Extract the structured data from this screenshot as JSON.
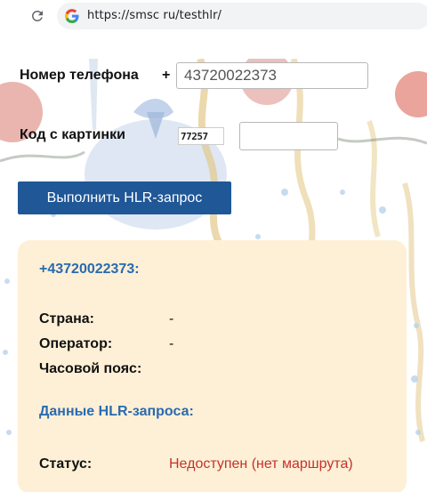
{
  "browser": {
    "url": "https://smsc ru/testhlr/"
  },
  "form": {
    "phone_label": "Номер телефона",
    "plus_sign": "+",
    "phone_value": "43720022373",
    "captcha_label": "Код с картинки",
    "captcha_code": "77257",
    "captcha_value": "",
    "submit_label": "Выполнить HLR-запрос"
  },
  "result": {
    "phone_heading": "+43720022373:",
    "rows": [
      {
        "label": "Страна:",
        "value": "-"
      },
      {
        "label": "Оператор:",
        "value": "-"
      },
      {
        "label": "Часовой пояс:",
        "value": ""
      }
    ],
    "hlr_heading": "Данные HLR-запроса:",
    "status_label": "Статус:",
    "status_value": "Недоступен (нет маршрута)"
  },
  "colors": {
    "button_bg": "#1f5797",
    "link_blue": "#2a6ab0",
    "panel_bg": "#fdf0d6",
    "status_error": "#c8312b"
  },
  "icons": {
    "reload": "reload-icon",
    "google": "google-icon"
  }
}
